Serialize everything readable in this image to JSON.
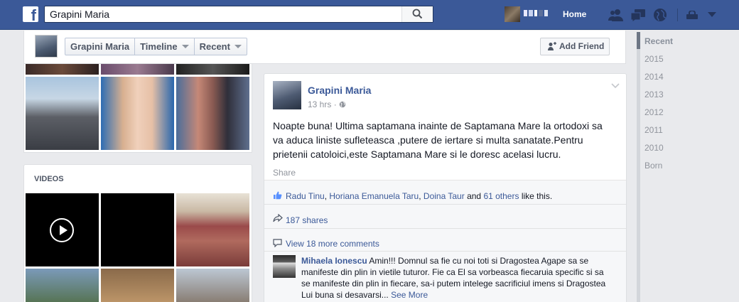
{
  "topbar": {
    "search_value": "Grapini Maria",
    "home_label": "Home"
  },
  "profile_header": {
    "name": "Grapini Maria",
    "tabs": [
      {
        "label": "Grapini Maria"
      },
      {
        "label": "Timeline"
      },
      {
        "label": "Recent"
      }
    ],
    "add_friend_label": "Add Friend"
  },
  "left": {
    "videos_title": "VIDEOS"
  },
  "post": {
    "author": "Grapini Maria",
    "time": "13 hrs",
    "time_sep": "·",
    "text": "Noapte buna! Ultima saptamana inainte de Saptamana Mare la ortodoxi sa va aduca liniste sufleteasca ,putere de iertare si multa sanatate.Pentru prietenii catoloici,este Saptamana Mare si le doresc acelasi lucru.",
    "share_label": "Share",
    "likes": {
      "names": [
        "Radu Tinu",
        "Horiana Emanuela Taru",
        "Doina Taur"
      ],
      "sep": ", ",
      "and": " and ",
      "others": "61 others",
      "suffix": " like this."
    },
    "shares": "187 shares",
    "more_comments": "View 18 more comments",
    "comment": {
      "author": "Mihaela Ionescu",
      "text": " Amin!!! Domnul sa fie cu noi toti si Dragostea Agape sa se manifeste din plin in vietile tuturor. Fie ca El sa vorbeasca fiecaruia specific si sa se manifeste din plin in fiecare, sa-i putem intelege sacrificiul imens si Dragostea Lui buna si desavarsi...",
      "see_more": "See More"
    }
  },
  "timeline_nav": {
    "items": [
      "Recent",
      "2015",
      "2014",
      "2013",
      "2012",
      "2011",
      "2010",
      "Born"
    ]
  },
  "colors": {
    "brand": "#3b5998",
    "page_bg": "#e9eaed",
    "link": "#3b5998",
    "muted": "#90949c"
  }
}
